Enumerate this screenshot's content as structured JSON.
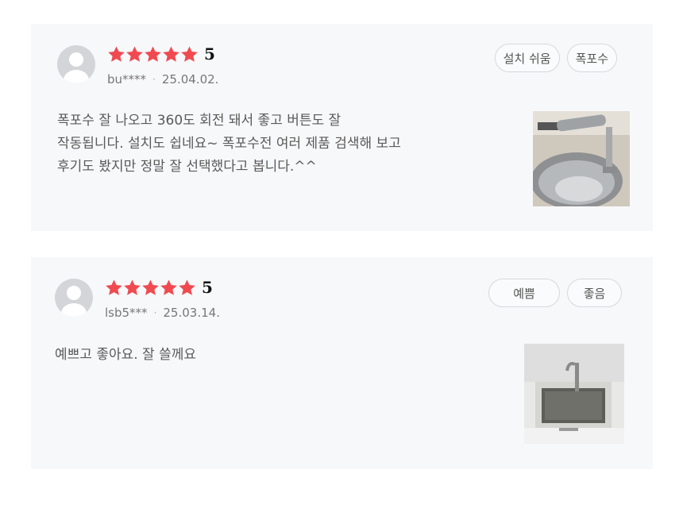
{
  "reviews": [
    {
      "rating": "5",
      "stars": 5,
      "user": "bu****",
      "date": "25.04.02.",
      "tags": [
        "설치 쉬움",
        "폭포수"
      ],
      "text_lines": [
        "폭포수 잘 나오고 360도 회전 돼서 좋고 버튼도 잘",
        "작동됩니다. 설치도 쉽네요~ 폭포수전 여러 제품 검색해 보고",
        "후기도 봤지만 정말 잘 선택했다고 봅니다.^^"
      ],
      "photo_icon": "kitchen-faucet-photo"
    },
    {
      "rating": "5",
      "stars": 5,
      "user": "lsb5***",
      "date": "25.03.14.",
      "tags": [
        "예쁨",
        "좋음"
      ],
      "text_lines": [
        "예쁘고 좋아요. 잘 쓸께요"
      ],
      "photo_icon": "sink-photo"
    }
  ],
  "colors": {
    "star": "#f04a50",
    "card_bg": "#f7f8fa",
    "tag_border": "#d6d8dc"
  }
}
